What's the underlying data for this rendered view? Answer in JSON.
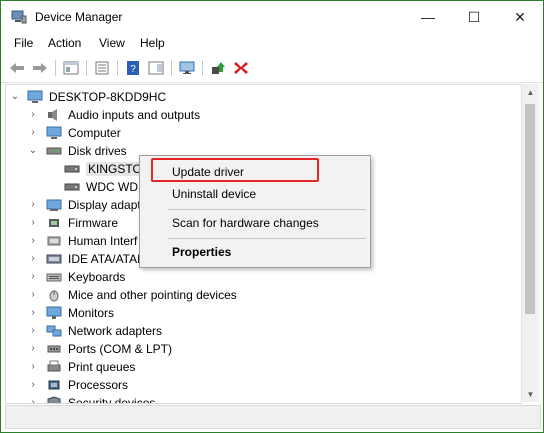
{
  "window": {
    "title": "Device Manager",
    "minimize_glyph": "—",
    "maximize_glyph": "☐",
    "close_glyph": "✕"
  },
  "menu": [
    "File",
    "Action",
    "View",
    "Help"
  ],
  "tree": {
    "root": "DESKTOP-8KDD9HC",
    "items": [
      {
        "label": "Audio inputs and outputs",
        "icon": "speaker-icon"
      },
      {
        "label": "Computer",
        "icon": "computer-icon"
      },
      {
        "label": "Disk drives",
        "icon": "disk-icon",
        "expanded": true
      },
      {
        "label": "KINGSTON",
        "icon": "drive-icon",
        "child": true,
        "selected": true
      },
      {
        "label": "WDC WD",
        "icon": "drive-icon",
        "child": true
      },
      {
        "label": "Display adapt",
        "icon": "display-icon"
      },
      {
        "label": "Firmware",
        "icon": "chip-icon"
      },
      {
        "label": "Human Interf",
        "icon": "hid-icon"
      },
      {
        "label": "IDE ATA/ATAP",
        "icon": "ide-icon"
      },
      {
        "label": "Keyboards",
        "icon": "keyboard-icon"
      },
      {
        "label": "Mice and other pointing devices",
        "icon": "mouse-icon"
      },
      {
        "label": "Monitors",
        "icon": "monitor-icon"
      },
      {
        "label": "Network adapters",
        "icon": "network-icon"
      },
      {
        "label": "Ports (COM & LPT)",
        "icon": "port-icon"
      },
      {
        "label": "Print queues",
        "icon": "printer-icon"
      },
      {
        "label": "Processors",
        "icon": "cpu-icon"
      },
      {
        "label": "Security devices",
        "icon": "security-icon"
      }
    ]
  },
  "context_menu": {
    "update_driver": "Update driver",
    "uninstall_device": "Uninstall device",
    "scan": "Scan for hardware changes",
    "properties": "Properties"
  },
  "colors": {
    "highlight": "#e52626",
    "window_border": "#2d7d2d"
  }
}
